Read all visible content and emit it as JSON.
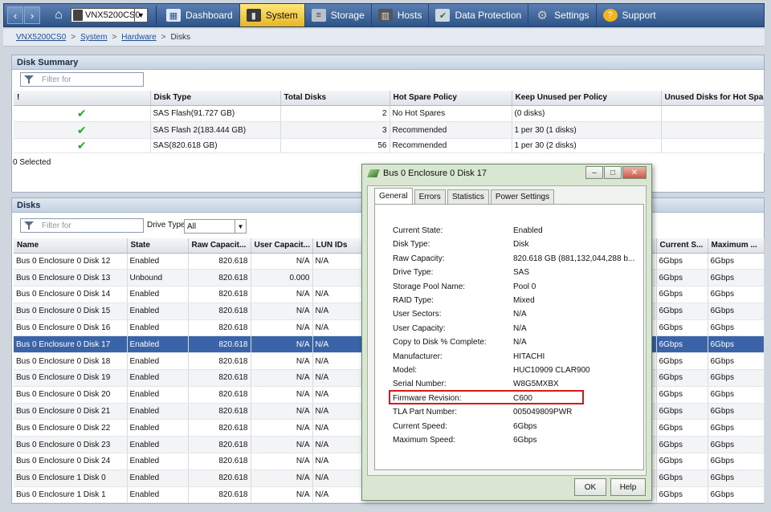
{
  "nav": {
    "back_glyph": "‹",
    "forward_glyph": "›",
    "system_name": "VNX5200CS0",
    "items": [
      {
        "label": "Dashboard",
        "icon": "dashboard-icon"
      },
      {
        "label": "System",
        "icon": "system-icon"
      },
      {
        "label": "Storage",
        "icon": "storage-icon"
      },
      {
        "label": "Hosts",
        "icon": "hosts-icon"
      },
      {
        "label": "Data Protection",
        "icon": "data-protection-icon"
      },
      {
        "label": "Settings",
        "icon": "gear-icon"
      },
      {
        "label": "Support",
        "icon": "support-icon"
      }
    ],
    "active": "System"
  },
  "breadcrumb": [
    "VNX5200CS0",
    "System",
    "Hardware",
    "Disks"
  ],
  "disk_summary": {
    "title": "Disk Summary",
    "filter_placeholder": "Filter for",
    "columns": [
      "!",
      "Disk Type",
      "Total Disks",
      "Hot Spare Policy",
      "Keep Unused per Policy",
      "Unused Disks for Hot Spa"
    ],
    "rows": [
      {
        "type": "SAS Flash(91.727 GB)",
        "total": "2",
        "policy": "No Hot Spares",
        "keep": "(0 disks)"
      },
      {
        "type": "SAS Flash 2(183.444 GB)",
        "total": "3",
        "policy": "Recommended",
        "keep": "1 per 30 (1 disks)"
      },
      {
        "type": "SAS(820.618 GB)",
        "total": "56",
        "policy": "Recommended",
        "keep": "1 per 30 (2 disks)"
      }
    ],
    "selected_text": "0 Selected"
  },
  "disks": {
    "title": "Disks",
    "filter_placeholder": "Filter for",
    "drive_type_label": "Drive Type",
    "drive_type_value": "All",
    "columns": [
      "Name",
      "State",
      "Raw Capacit...",
      "User Capacit...",
      "LUN IDs"
    ],
    "right_columns": [
      "Current S...",
      "Maximum ..."
    ],
    "rows": [
      {
        "name": "Bus 0 Enclosure 0 Disk 12",
        "state": "Enabled",
        "raw": "820.618",
        "user": "N/A",
        "lun": "N/A",
        "cur": "6Gbps",
        "max": "6Gbps"
      },
      {
        "name": "Bus 0 Enclosure 0 Disk 13",
        "state": "Unbound",
        "raw": "820.618",
        "user": "0.000",
        "lun": "",
        "cur": "6Gbps",
        "max": "6Gbps"
      },
      {
        "name": "Bus 0 Enclosure 0 Disk 14",
        "state": "Enabled",
        "raw": "820.618",
        "user": "N/A",
        "lun": "N/A",
        "cur": "6Gbps",
        "max": "6Gbps"
      },
      {
        "name": "Bus 0 Enclosure 0 Disk 15",
        "state": "Enabled",
        "raw": "820.618",
        "user": "N/A",
        "lun": "N/A",
        "cur": "6Gbps",
        "max": "6Gbps"
      },
      {
        "name": "Bus 0 Enclosure 0 Disk 16",
        "state": "Enabled",
        "raw": "820.618",
        "user": "N/A",
        "lun": "N/A",
        "cur": "6Gbps",
        "max": "6Gbps"
      },
      {
        "name": "Bus 0 Enclosure 0 Disk 17",
        "state": "Enabled",
        "raw": "820.618",
        "user": "N/A",
        "lun": "N/A",
        "cur": "6Gbps",
        "max": "6Gbps"
      },
      {
        "name": "Bus 0 Enclosure 0 Disk 18",
        "state": "Enabled",
        "raw": "820.618",
        "user": "N/A",
        "lun": "N/A",
        "cur": "6Gbps",
        "max": "6Gbps"
      },
      {
        "name": "Bus 0 Enclosure 0 Disk 19",
        "state": "Enabled",
        "raw": "820.618",
        "user": "N/A",
        "lun": "N/A",
        "cur": "6Gbps",
        "max": "6Gbps"
      },
      {
        "name": "Bus 0 Enclosure 0 Disk 20",
        "state": "Enabled",
        "raw": "820.618",
        "user": "N/A",
        "lun": "N/A",
        "cur": "6Gbps",
        "max": "6Gbps"
      },
      {
        "name": "Bus 0 Enclosure 0 Disk 21",
        "state": "Enabled",
        "raw": "820.618",
        "user": "N/A",
        "lun": "N/A",
        "cur": "6Gbps",
        "max": "6Gbps"
      },
      {
        "name": "Bus 0 Enclosure 0 Disk 22",
        "state": "Enabled",
        "raw": "820.618",
        "user": "N/A",
        "lun": "N/A",
        "cur": "6Gbps",
        "max": "6Gbps"
      },
      {
        "name": "Bus 0 Enclosure 0 Disk 23",
        "state": "Enabled",
        "raw": "820.618",
        "user": "N/A",
        "lun": "N/A",
        "cur": "6Gbps",
        "max": "6Gbps"
      },
      {
        "name": "Bus 0 Enclosure 0 Disk 24",
        "state": "Enabled",
        "raw": "820.618",
        "user": "N/A",
        "lun": "N/A",
        "cur": "6Gbps",
        "max": "6Gbps"
      },
      {
        "name": "Bus 0 Enclosure 1 Disk 0",
        "state": "Enabled",
        "raw": "820.618",
        "user": "N/A",
        "lun": "N/A",
        "cur": "6Gbps",
        "max": "6Gbps"
      },
      {
        "name": "Bus 0 Enclosure 1 Disk 1",
        "state": "Enabled",
        "raw": "820.618",
        "user": "N/A",
        "lun": "N/A",
        "cur": "6Gbps",
        "max": "6Gbps"
      }
    ],
    "selected_index": 5
  },
  "dialog": {
    "title": "Bus 0 Enclosure 0 Disk 17",
    "tabs": [
      "General",
      "Errors",
      "Statistics",
      "Power Settings"
    ],
    "active_tab": "General",
    "properties": [
      {
        "k": "Current State:",
        "v": "Enabled"
      },
      {
        "k": "Disk Type:",
        "v": "Disk"
      },
      {
        "k": "Raw Capacity:",
        "v": "820.618 GB  (881,132,044,288 b..."
      },
      {
        "k": "Drive Type:",
        "v": "SAS"
      },
      {
        "k": "Storage Pool Name:",
        "v": "Pool 0"
      },
      {
        "k": "RAID Type:",
        "v": "Mixed"
      },
      {
        "k": "User Sectors:",
        "v": "N/A"
      },
      {
        "k": "User Capacity:",
        "v": "N/A"
      },
      {
        "k": "Copy to Disk % Complete:",
        "v": "N/A"
      },
      {
        "k": "Manufacturer:",
        "v": "HITACHI"
      },
      {
        "k": "Model:",
        "v": "HUC10909 CLAR900"
      },
      {
        "k": "Serial Number:",
        "v": "W8G5MXBX"
      },
      {
        "k": "Firmware Revision:",
        "v": "C600"
      },
      {
        "k": "TLA Part Number:",
        "v": "005049809PWR"
      },
      {
        "k": "Current Speed:",
        "v": "6Gbps"
      },
      {
        "k": "Maximum Speed:",
        "v": "6Gbps"
      }
    ],
    "ok_label": "OK",
    "help_label": "Help",
    "highlight_color": "#d11a1a"
  }
}
